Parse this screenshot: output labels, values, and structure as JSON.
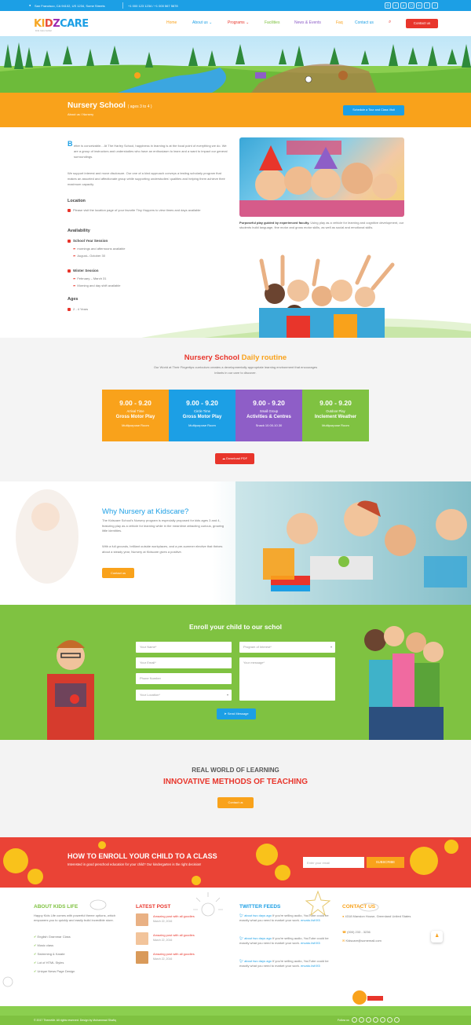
{
  "topbar": {
    "address": "San Francisco, CA 94102, US 1234, Some Streets",
    "phones": "+1 000 123 1234 / +1 000 567 5678",
    "social_icons": [
      "dribbble-icon",
      "vimeo-icon",
      "pinterest-icon",
      "instagram-icon",
      "linkedin-icon",
      "twitter-icon",
      "facebook-icon"
    ]
  },
  "brand": {
    "logo_k": "KI",
    "logo_d": "D",
    "logo_z": "Z",
    "logo_c": "CARE",
    "tagline": "Kids Care Center"
  },
  "nav": {
    "items": [
      "Home",
      "About us",
      "Programs",
      "Facilities",
      "News & Events",
      "Faq",
      "Contact us"
    ],
    "cta": "Contact us"
  },
  "page": {
    "title": "Nursery School",
    "title_suffix": "( ages 3 to 4 )",
    "breadcrumb": "About us / Nursery",
    "schedule_button": "Schedule a Tour and Class Visit"
  },
  "intro": {
    "dropcap": "B",
    "p1": "etter is conceivable... At The Harley School, happiness in learning is at the focal point of everything we do. We are a group of instructors and understudies who have an enthusiasm to learn and a want to impact our general surroundings.",
    "p2": "We support interest and move disclosure. Our one of a kind approach conveys a testing scholarly program that makes an assorted and affectionate group while supporting understudies' qualities and helping them achieve their maximum capacity.",
    "location_title": "Location",
    "location_text": "Please visit the location page of your favorite Tiny Hoppers to view times and days available",
    "availability_title": "Availability",
    "school_year_title": "School Year Session",
    "school_year_items": [
      "mornings and afternoons available",
      "August– October 30"
    ],
    "winter_title": "Winter Session",
    "winter_items": [
      "February – March 31",
      "Morning and day shift available"
    ],
    "ages_title": "Ages",
    "ages_text": "2 - 4 Years",
    "caption_bold": "Purposeful play guided by experienced faculty.",
    "caption_text": "Using play as a vehicle for learning and cognitive development, our students build language, fine motor and gross motor skills, as well as social and emotional skills."
  },
  "routine": {
    "title_a": "Nursery School",
    "title_b": "Daily routine",
    "desc": "Our World at Their Fingertips curriculum creates a developmentally appropriate learning environment that encourages infants in our care to discover.",
    "cards": [
      {
        "time": "9.00 - 9.20",
        "sub": "Arrival Time",
        "name": "Gross Motor Play",
        "room": "Multipurpose Room",
        "color": "#f9a21b"
      },
      {
        "time": "9.00 - 9.20",
        "sub": "Circle Time",
        "name": "Gross Motor Play",
        "room": "Multipurpose Room",
        "color": "#1c9fe5"
      },
      {
        "time": "9.00 - 9.20",
        "sub": "Small Group",
        "name": "Activities & Centres",
        "room": "Snack 10.00-10.30",
        "color": "#8e5ec7"
      },
      {
        "time": "9.00 - 9.20",
        "sub": "Outdoor Play",
        "name": "Inclement Weather",
        "room": "Multipurpose Room",
        "color": "#7fc241"
      }
    ],
    "download": "Download PDF"
  },
  "why": {
    "title": "Why Nursery at Kidscare?",
    "p1": "The Kidscare School's Nursery program is especially proposed for kids ages 3 and 4, featuring play as a vehicle for learning while in the meantime attracting curious, growing little identities.",
    "p2": "With a full grounds, brilliant outside workplaces, and a pre-summer elective that thrives about a steady year, Nursery at Kidscare gives a positive.",
    "button": "Contact us"
  },
  "enroll": {
    "title": "Enroll your child to our schol",
    "name_ph": "Your Name*",
    "email_ph": "Your Email*",
    "phone_ph": "Phone Number",
    "location_ph": "Your Location*",
    "program_ph": "Program of Interest*",
    "message_ph": "Your message*",
    "send": "Send Message"
  },
  "learning": {
    "line1": "REAL WORLD OF LEARNING",
    "line2": "INNOVATIVE METHODS OF TEACHING",
    "button": "Contact us"
  },
  "subscribe": {
    "title": "HOW TO ENROLL YOUR CHILD TO A CLASS",
    "subtitle": "Interested in good preschool education for your child? Our kindergarten is the right decision!",
    "placeholder": "Enter your email",
    "button": "SUBSCRIBE"
  },
  "footer": {
    "about_title": "ABOUT KIDS LIFE",
    "about_text": "Happy Kids Life comes with powerful theme options, which empowers you to quickly and easily build incredible store.",
    "about_items": [
      "English Grammar Class",
      "Music class",
      "Swimming & Karate",
      "Lot of HTML Styles",
      "Unique News Page Design"
    ],
    "latest_title": "LATEST POST",
    "posts": [
      {
        "title": "Amazing post with all goodies",
        "date": "March 22, 2016"
      },
      {
        "title": "Amazing post with all goodies",
        "date": "March 22, 2016"
      },
      {
        "title": "Amazing post with all goodies",
        "date": "March 22, 2016"
      }
    ],
    "twitter_title": "TWITTER FEEDS",
    "tweets": [
      {
        "time": "about two days ago",
        "text": "If you're selling audio, YouTube could be exactly what you need to market your work.",
        "link": "envato.l/sKK5"
      },
      {
        "time": "about two days ago",
        "text": "If you're selling audio, YouTube could be exactly what you need to market your work.",
        "link": "envato.l/sKK5"
      },
      {
        "time": "about two days ago",
        "text": "If you're selling audio, YouTube could be exactly what you need to market your work.",
        "link": "envato.l/sKK5"
      }
    ],
    "contact_title": "CONTACT US",
    "address": "4318 Mansion House, Greenland United States",
    "phone": "(000) 233 - 3236",
    "email": "Kidscare@somemail.com",
    "copyright": "© 2017 ThemeMr. All rights reserved. Design by Muhammad Shafiq",
    "follow": "Follow us"
  },
  "colors": {
    "blue": "#1c9fe5",
    "orange": "#f9a21b",
    "red": "#e8352b",
    "green": "#7fc241",
    "purple": "#8e5ec7"
  }
}
